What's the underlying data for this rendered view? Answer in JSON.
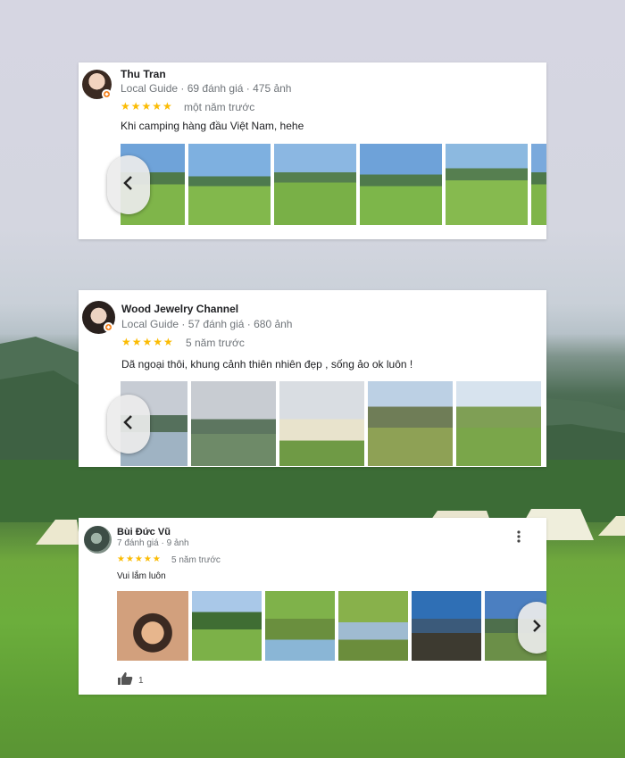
{
  "reviews": [
    {
      "name": "Thu Tran",
      "meta": "Local Guide · 69 đánh giá · 475 ảnh",
      "stars": "★★★★★",
      "when": "một năm trước",
      "text": "Khi camping hàng đầu Việt Nam, hehe"
    },
    {
      "name": "Wood Jewelry Channel",
      "meta": "Local Guide · 57 đánh giá · 680 ảnh",
      "stars": "★★★★★",
      "when": "5 năm trước",
      "text": "Dã ngoại thôi,  khung cảnh thiên nhiên đẹp , sống ảo ok luôn !"
    },
    {
      "name": "Bùi Đức Vũ",
      "meta": "7 đánh giá · 9 ảnh",
      "stars": "★★★★★",
      "when": "5 năm trước",
      "text": "Vui lắm luôn",
      "likes": "1"
    }
  ],
  "colors": {
    "star": "#fbbc04",
    "local_guide_badge": "#f5821f",
    "grass": "#6cae3c",
    "sky": "#d6d6e2"
  },
  "icons": {
    "prev": "chevron-left-icon",
    "next": "chevron-right-icon",
    "more": "more-vert-icon",
    "like": "thumb-up-icon"
  }
}
